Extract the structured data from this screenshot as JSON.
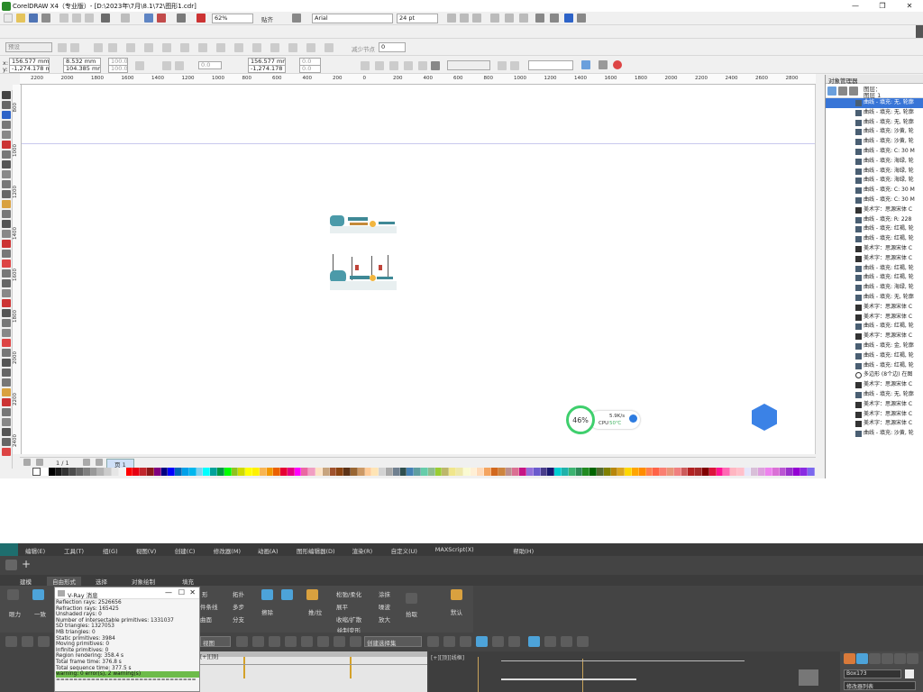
{
  "window": {
    "title": "CorelDRAW X4（专业版）- [D:\\2023年\\7月\\8.1\\72\\图形1.cdr]"
  },
  "standard_toolbar": {
    "zoom": "62%",
    "snap_label": "贴齐",
    "font_name": "Arial",
    "font_size": "24 pt"
  },
  "property_bar": {
    "preset": "预设",
    "reduce_nodes_label": "减少节点",
    "reduce_nodes_value": "0"
  },
  "coords": {
    "x": "156.577 mm",
    "y": "-1,274.178 mm",
    "w": "8.532 mm",
    "h": "104.385 mm",
    "sx": "100.0",
    "sy": "100.0",
    "angle": "0.0",
    "x2": "156.577 mm",
    "y2": "-1,274.178 mm",
    "r1": "0.0",
    "r2": "0.0"
  },
  "hruler_ticks": [
    "2200",
    "2000",
    "1800",
    "1600",
    "1400",
    "1200",
    "1000",
    "800",
    "600",
    "400",
    "200",
    "0",
    "200",
    "400",
    "600",
    "800",
    "1000",
    "1200",
    "1400",
    "1600",
    "1800",
    "2000",
    "2200",
    "2400",
    "2600",
    "2800"
  ],
  "vruler_ticks": [
    "800",
    "1000",
    "1200",
    "1400",
    "1600",
    "1800",
    "2000",
    "2200",
    "2400"
  ],
  "pagebar": {
    "page_counter": "1 / 1",
    "page_tab": "页 1"
  },
  "object_manager": {
    "title": "对象管理器",
    "layer_label": "图层：",
    "layer_name": "图层 1",
    "rows": [
      "曲线 - 填充: 无, 轮廓",
      "曲线 - 填充: 无, 轮廓",
      "曲线 - 填充: 无, 轮廓",
      "曲线 - 填充: 沙黄, 轮",
      "曲线 - 填充: 沙黄, 轮",
      "曲线 - 填充: C: 30 M",
      "曲线 - 填充: 海绿, 轮",
      "曲线 - 填充: 海绿, 轮",
      "曲线 - 填充: 海绿, 轮",
      "曲线 - 填充: C: 30 M",
      "曲线 - 填充: C: 30 M",
      "美术字：思源宋体 C",
      "曲线 - 填充: R: 228",
      "曲线 - 填充: 红褐, 轮",
      "曲线 - 填充: 红褐, 轮",
      "美术字：思源宋体 C",
      "美术字：思源宋体 C",
      "曲线 - 填充: 红褐, 轮",
      "曲线 - 填充: 红褐, 轮",
      "曲线 - 填充: 海绿, 轮",
      "曲线 - 填充: 无, 轮廓",
      "美术字：思源宋体 C",
      "美术字：思源宋体 C",
      "曲线 - 填充: 红褐, 轮",
      "美术字：思源宋体 C",
      "曲线 - 填充: 金, 轮廓",
      "曲线 - 填充: 红褐, 轮",
      "曲线 - 填充: 红褐, 轮",
      "多边形 (8个边) 在图",
      "美术字：思源宋体 C",
      "曲线 - 填充: 无, 轮廓",
      "美术字：思源宋体 C",
      "美术字：思源宋体 C",
      "美术字：思源宋体 C",
      "曲线 - 填充: 沙黄, 轮"
    ]
  },
  "speed_widget": {
    "percent": "46%",
    "speed": "5.9K/s",
    "cpu_label": "CPU",
    "cpu_temp": "50℃"
  },
  "palette_colors": [
    "#ffffff",
    "#000000",
    "#1a1a1a",
    "#333333",
    "#4d4d4d",
    "#666666",
    "#808080",
    "#999999",
    "#b3b3b3",
    "#cccccc",
    "#e6e6e6",
    "#f2f2f2",
    "#ff0000",
    "#e60012",
    "#c1272d",
    "#8b1a1a",
    "#800080",
    "#000080",
    "#0000ff",
    "#0068b7",
    "#00a0e9",
    "#00b7ee",
    "#7fd0ee",
    "#00ffff",
    "#00a29a",
    "#009944",
    "#00ff00",
    "#8fc31f",
    "#cfdb00",
    "#ffff00",
    "#fff100",
    "#f8b551",
    "#f39800",
    "#eb6100",
    "#e60033",
    "#e4007f",
    "#ff00ff",
    "#ea68a2",
    "#f19ec2",
    "#fce2c4",
    "#c7a47e",
    "#a0522d",
    "#8b4513",
    "#5c3317",
    "#996633",
    "#cc9966",
    "#ffcc99",
    "#ffe4b5",
    "#d3d3d3",
    "#a9a9a9",
    "#708090",
    "#2f4f4f",
    "#4682b4",
    "#5f9ea0",
    "#66cdaa",
    "#8fbc8f",
    "#9acd32",
    "#bdb76b",
    "#f0e68c",
    "#eee8aa",
    "#fafad2",
    "#ffefd5",
    "#ffdab9",
    "#f4a460",
    "#d2691e",
    "#cd853f",
    "#bc8f8f",
    "#db7093",
    "#c71585",
    "#9370db",
    "#6a5acd",
    "#483d8b",
    "#191970",
    "#00ced1",
    "#20b2aa",
    "#3cb371",
    "#2e8b57",
    "#228b22",
    "#006400",
    "#556b2f",
    "#808000",
    "#b8860b",
    "#daa520",
    "#ffd700",
    "#ffa500",
    "#ff8c00",
    "#ff7f50",
    "#ff6347",
    "#fa8072",
    "#e9967a",
    "#f08080",
    "#cd5c5c",
    "#b22222",
    "#a52a2a",
    "#800000",
    "#dc143c",
    "#ff1493",
    "#ff69b4",
    "#ffb6c1",
    "#ffc0cb",
    "#e6e6fa",
    "#d8bfd8",
    "#dda0dd",
    "#ee82ee",
    "#da70d6",
    "#ba55d3",
    "#9932cc",
    "#9400d3",
    "#8a2be2",
    "#7b68ee"
  ],
  "max_menu": [
    "编辑(E)",
    "工具(T)",
    "组(G)",
    "视图(V)",
    "创建(C)",
    "修改器(M)",
    "动画(A)",
    "图形编辑器(D)",
    "渲染(R)",
    "自定义(U)",
    "MAXScript(X)",
    "帮助(H)"
  ],
  "ribbon_tabs": [
    "建模",
    "自由形式",
    "选择",
    "对象绘制",
    "填充"
  ],
  "ribbon": {
    "left_btn1": "眼力",
    "left_btn2": "一致",
    "g1": [
      "形",
      "件条线",
      "曲面"
    ],
    "g2": [
      "拓扑",
      "多步",
      "分支"
    ],
    "erase": "擦除",
    "push": "推/拉",
    "ops": [
      "松弛/柔化",
      "展平",
      "收缩/扩散"
    ],
    "ops2": [
      "涂抹",
      "噪波",
      "放大"
    ],
    "pick": "拾取",
    "default": "默认",
    "section_label": "绘制变形"
  },
  "vray": {
    "title": "V-Ray 消息",
    "lines": [
      "Reflection rays: 2526656",
      "Refraction rays: 165425",
      "Unshaded rays: 0",
      "Number of intersectable primitives: 1331037",
      "  SD triangles: 1327053",
      "  MB triangles: 0",
      "  Static primitives: 3984",
      "  Moving primitives: 0",
      "  Infinite primitives: 0",
      "Region rendering: 358.4 s",
      "Total frame time: 376.8 s",
      "Total sequence time: 377.5 s"
    ],
    "warning": "warning: 0 error(s), 2 warning(s)",
    "separator": "================================"
  },
  "viewport": {
    "view_label": "视图",
    "selset": "创建选择集",
    "label1": "[+][顶]",
    "label2": "[+][顶][线框]"
  },
  "max_right": {
    "obj_name": "Box173",
    "modlist": "修改器列表"
  }
}
